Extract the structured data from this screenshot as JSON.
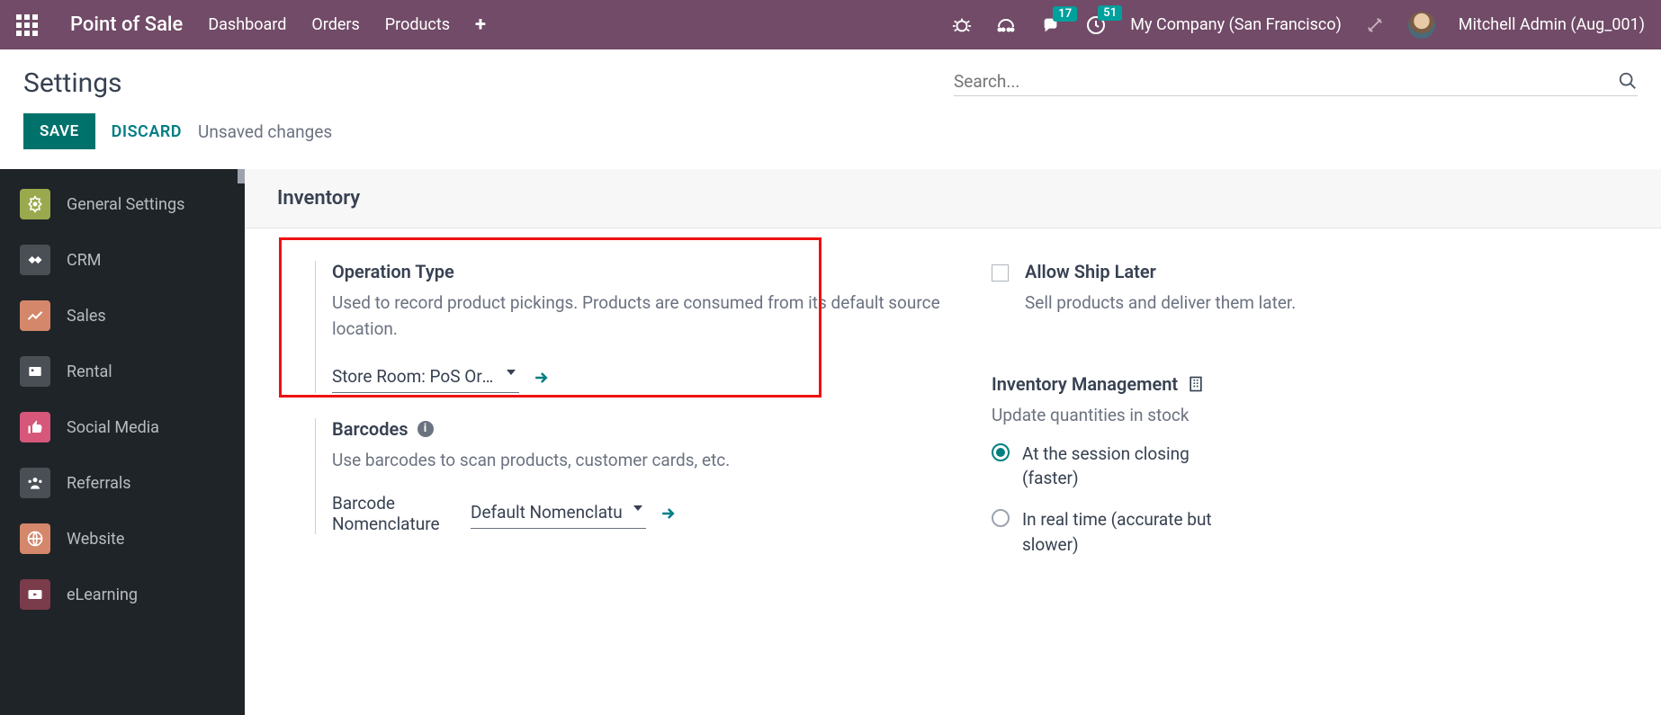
{
  "nav": {
    "brand": "Point of Sale",
    "items": [
      "Dashboard",
      "Orders",
      "Products"
    ],
    "msg_badge": "17",
    "act_badge": "51",
    "company": "My Company (San Francisco)",
    "user": "Mitchell Admin (Aug_001)"
  },
  "page": {
    "title": "Settings",
    "search_placeholder": "Search...",
    "save": "SAVE",
    "discard": "DISCARD",
    "unsaved": "Unsaved changes"
  },
  "sidebar": {
    "items": [
      {
        "label": "General Settings"
      },
      {
        "label": "CRM"
      },
      {
        "label": "Sales"
      },
      {
        "label": "Rental"
      },
      {
        "label": "Social Media"
      },
      {
        "label": "Referrals"
      },
      {
        "label": "Website"
      },
      {
        "label": "eLearning"
      }
    ]
  },
  "section": {
    "title": "Inventory"
  },
  "op_type": {
    "title": "Operation Type",
    "desc": "Used to record product pickings. Products are consumed from its default source location.",
    "value": "Store Room: PoS Orde"
  },
  "barcodes": {
    "title": "Barcodes",
    "desc": "Use barcodes to scan products, customer cards, etc.",
    "field_label": "Barcode Nomenclature",
    "value": "Default Nomenclatu"
  },
  "ship_later": {
    "title": "Allow Ship Later",
    "desc": "Sell products and deliver them later."
  },
  "inv_mgmt": {
    "title": "Inventory Management",
    "desc": "Update quantities in stock",
    "opt1": "At the session closing (faster)",
    "opt2": "In real time (accurate but slower)"
  }
}
